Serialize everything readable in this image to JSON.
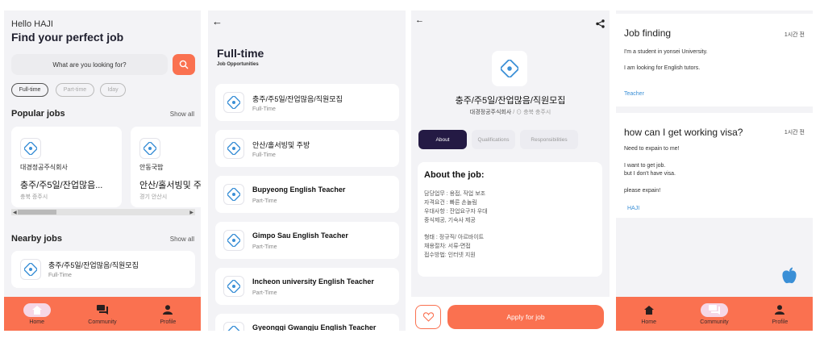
{
  "screen1": {
    "greeting": "Hello HAJI",
    "headline": "Find your perfect job",
    "search_placeholder": "What are you looking for?",
    "filters": [
      "Full-time",
      "Part-time",
      "Iday"
    ],
    "popular": {
      "title": "Popular jobs",
      "show_all": "Show all",
      "cards": [
        {
          "company": "대경정공주식회사",
          "title": "충주/주5일/잔업많음...",
          "location": "충북 증주시"
        },
        {
          "company": "안동국밥",
          "title": "안산/홀서빙및 주방",
          "location": "경기 안산시"
        }
      ]
    },
    "nearby": {
      "title": "Nearby jobs",
      "show_all": "Show all",
      "cards": [
        {
          "title": "충주/주5일/잔업많음/직원모집",
          "type": "Full-Time"
        }
      ]
    }
  },
  "nav": {
    "home": "Home",
    "community": "Community",
    "profile": "Profile"
  },
  "screen2": {
    "title": "Full-time",
    "subtitle": "Job Opportunities",
    "jobs": [
      {
        "title": "충주/주5일/잔업많음/직원모집",
        "type": "Full-Time"
      },
      {
        "title": "안산/홀서빙및 주방",
        "type": "Full-Time"
      },
      {
        "title": "Bupyeong English Teacher",
        "type": "Part-Time"
      },
      {
        "title": "Gimpo Sau English Teacher",
        "type": "Part-Time"
      },
      {
        "title": "Incheon university English Teacher",
        "type": "Part-Time"
      },
      {
        "title": "Gyeonggi Gwangju English Teacher",
        "type": ""
      }
    ]
  },
  "screen3": {
    "job_title": "충주/주5일/잔업많음/직원모집",
    "company": "대경정공주식회사",
    "location": "충북 충주시",
    "tabs": [
      "About",
      "Qualifications",
      "Responsibilities"
    ],
    "about_heading": "About the job:",
    "about_lines": [
      "담당업무 : 용접, 작업 보조",
      "자격요건 : 빠른 손놀림",
      "우대사항 : 잔업요구자 우대",
      "중식제공, 기숙사 제공",
      "형태 : 정규직/ 아르바이트",
      "채용절차: 서류-면접",
      "접수방법: 인터넷 지원"
    ],
    "apply_label": "Apply for job"
  },
  "screen4": {
    "posts": [
      {
        "title": "Job finding",
        "time": "1시간 전",
        "lines": [
          "I'm a student in yonsei University.",
          "I am looking for English tutors."
        ],
        "author": "Teacher"
      },
      {
        "title": "how can I get working visa?",
        "time": "1시간 전",
        "lines": [
          "Need to expain to me!",
          "I want to get job.",
          "but I don't have visa.",
          "please expain!"
        ],
        "author": "HAJI"
      }
    ]
  },
  "colors": {
    "accent": "#fa7150",
    "dark": "#241a44",
    "link": "#3a8fd6"
  },
  "icons": {
    "logo": "job-logo-icon",
    "search": "search-icon",
    "back": "back-arrow-icon",
    "share": "share-icon",
    "heart": "heart-icon",
    "apple": "apple-icon"
  }
}
